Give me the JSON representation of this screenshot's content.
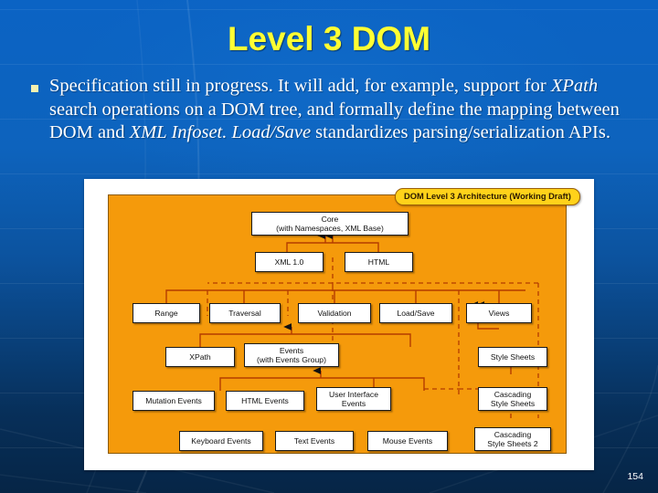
{
  "slide": {
    "title": "Level 3 DOM",
    "page_number": "154",
    "title_color": "#ffff33",
    "background_color": "#0b63c4",
    "body_text_color": "#ffffff"
  },
  "body": {
    "bullet_glyph": "square-bullet",
    "segments": [
      {
        "text": "Specification still in progress.  It will add, for example, support for ",
        "italic": false
      },
      {
        "text": "XPath",
        "italic": true
      },
      {
        "text": " search operations on a DOM tree, and formally define the mapping between DOM and ",
        "italic": false
      },
      {
        "text": "XML Infoset.",
        "italic": true
      },
      {
        "text": "  ",
        "italic": false
      },
      {
        "text": "Load/Save",
        "italic": true
      },
      {
        "text": " standardizes parsing/serialization APIs.",
        "italic": false
      }
    ],
    "plain_text": "Specification still in progress.  It will add, for example, support for XPath search operations on a DOM tree, and formally define the mapping between DOM and XML Infoset.  Load/Save standardizes parsing/serialization APIs."
  },
  "diagram": {
    "badge_label": "DOM Level 3 Architecture (Working Draft)",
    "panel_color": "#f59a0b",
    "connector_color": "#b43c00",
    "node_fill": "#ffffff",
    "nodes": [
      {
        "id": "core",
        "line1": "Core",
        "line2": "(with Namespaces, XML Base)"
      },
      {
        "id": "xml10",
        "line1": "XML 1.0",
        "line2": ""
      },
      {
        "id": "html",
        "line1": "HTML",
        "line2": ""
      },
      {
        "id": "range",
        "line1": "Range",
        "line2": ""
      },
      {
        "id": "traversal",
        "line1": "Traversal",
        "line2": ""
      },
      {
        "id": "validation",
        "line1": "Validation",
        "line2": ""
      },
      {
        "id": "loadsave",
        "line1": "Load/Save",
        "line2": ""
      },
      {
        "id": "views",
        "line1": "Views",
        "line2": ""
      },
      {
        "id": "xpath",
        "line1": "XPath",
        "line2": ""
      },
      {
        "id": "events",
        "line1": "Events",
        "line2": "(with Events Group)"
      },
      {
        "id": "stylesheets",
        "line1": "Style Sheets",
        "line2": ""
      },
      {
        "id": "mutation",
        "line1": "Mutation Events",
        "line2": ""
      },
      {
        "id": "htmlevents",
        "line1": "HTML Events",
        "line2": ""
      },
      {
        "id": "uievents",
        "line1": "User Interface",
        "line2": "Events"
      },
      {
        "id": "css",
        "line1": "Cascading",
        "line2": "Style Sheets"
      },
      {
        "id": "keyboard",
        "line1": "Keyboard Events",
        "line2": ""
      },
      {
        "id": "textevents",
        "line1": "Text Events",
        "line2": ""
      },
      {
        "id": "mouse",
        "line1": "Mouse Events",
        "line2": ""
      },
      {
        "id": "css2",
        "line1": "Cascading",
        "line2": "Style Sheets 2"
      }
    ]
  }
}
